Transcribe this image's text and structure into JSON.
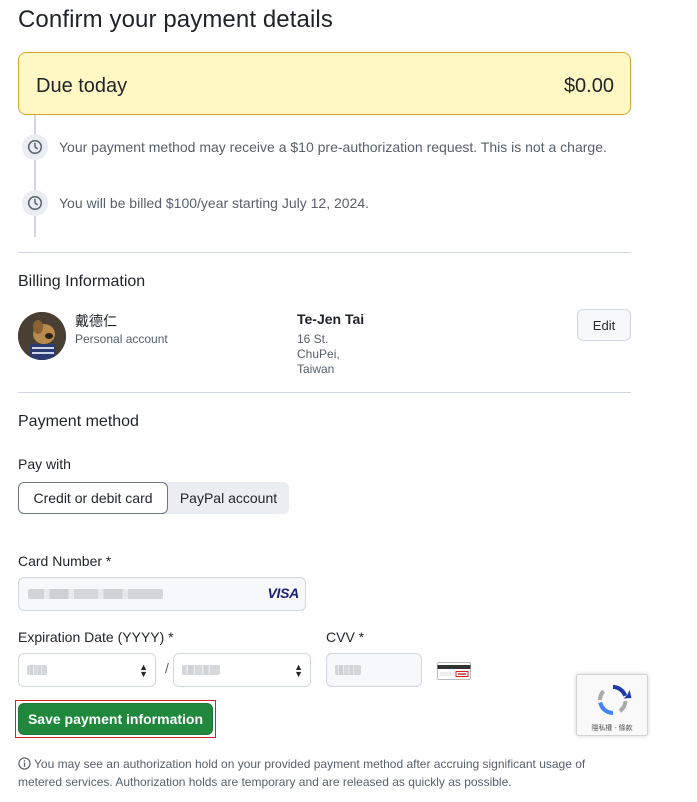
{
  "page": {
    "title": "Confirm your payment details"
  },
  "due": {
    "label": "Due today",
    "amount": "$0.00"
  },
  "timeline": [
    {
      "icon": "clock-icon",
      "text": "Your payment method may receive a $10 pre-authorization request. This is not a charge."
    },
    {
      "icon": "clock-icon",
      "text": "You will be billed $100/year starting July 12, 2024."
    }
  ],
  "billing": {
    "title": "Billing Information",
    "account_name": "戴德仁",
    "account_type": "Personal account",
    "bill_name": "Te-Jen Tai",
    "address_lines": [
      "16 St.",
      "ChuPei,",
      "Taiwan"
    ],
    "edit_label": "Edit"
  },
  "payment": {
    "title": "Payment method",
    "pay_with_label": "Pay with",
    "options": [
      {
        "label": "Credit or debit card",
        "selected": true
      },
      {
        "label": "PayPal account",
        "selected": false
      }
    ],
    "card_number_label": "Card Number *",
    "card_brand": "VISA",
    "expiration_label": "Expiration Date (YYYY) *",
    "expiration_separator": "/",
    "cvv_label": "CVV *",
    "save_label": "Save payment information"
  },
  "recaptcha": {
    "text": "隱私權 - 條款"
  },
  "note": {
    "text": "You may see an authorization hold on your provided payment method after accruing significant usage of metered services. Authorization holds are temporary and are released as quickly as possible."
  },
  "colors": {
    "due_bg": "#fff8c5",
    "due_border": "#d4a72c",
    "save_bg": "#1f883d",
    "focus_frame": "#cf222e"
  }
}
